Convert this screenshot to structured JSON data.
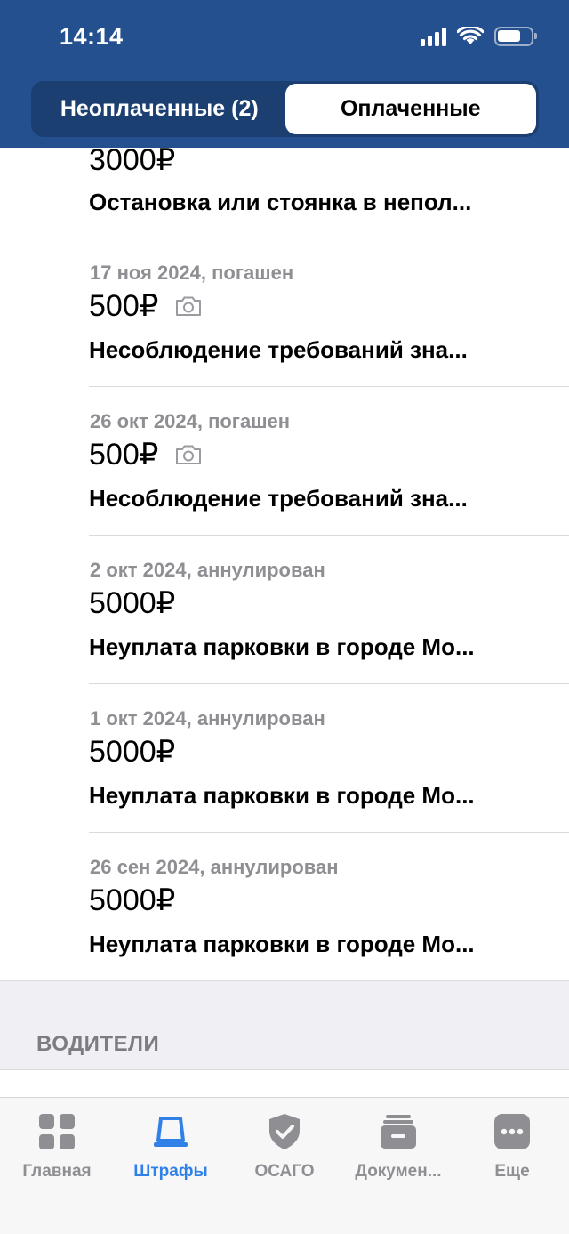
{
  "status_bar": {
    "time": "14:14"
  },
  "segmented": {
    "unpaid_label": "Неоплаченные (2)",
    "paid_label": "Оплаченные"
  },
  "fines": [
    {
      "date": "",
      "amount": "3000₽",
      "has_photo": false,
      "description": "Остановка или стоянка в непол..."
    },
    {
      "date": "17 ноя 2024, погашен",
      "amount": "500₽",
      "has_photo": true,
      "description": "Несоблюдение требований зна..."
    },
    {
      "date": "26 окт 2024, погашен",
      "amount": "500₽",
      "has_photo": true,
      "description": "Несоблюдение требований зна..."
    },
    {
      "date": "2 окт 2024, аннулирован",
      "amount": "5000₽",
      "has_photo": false,
      "description": "Неуплата парковки в городе Мо..."
    },
    {
      "date": "1 окт 2024, аннулирован",
      "amount": "5000₽",
      "has_photo": false,
      "description": "Неуплата парковки в городе Мо..."
    },
    {
      "date": "26 сен 2024, аннулирован",
      "amount": "5000₽",
      "has_photo": false,
      "description": "Неуплата парковки в городе Мо..."
    }
  ],
  "section": {
    "title": "ВОДИТЕЛИ"
  },
  "tabbar": {
    "items": [
      {
        "label": "Главная",
        "icon": "grid-icon",
        "active": false
      },
      {
        "label": "Штрафы",
        "icon": "siren-icon",
        "active": true
      },
      {
        "label": "ОСАГО",
        "icon": "shield-check-icon",
        "active": false
      },
      {
        "label": "Докумен...",
        "icon": "documents-icon",
        "active": false
      },
      {
        "label": "Еще",
        "icon": "more-icon",
        "active": false
      }
    ]
  },
  "colors": {
    "header_bg": "#24508f",
    "segmented_bg": "#1c3f72",
    "active_tab": "#2f80e7",
    "inactive_tab": "#8e8e93"
  }
}
